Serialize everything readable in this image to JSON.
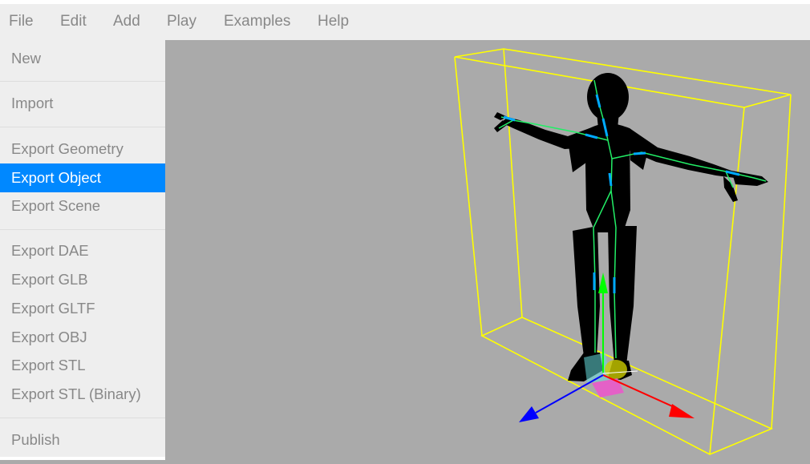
{
  "menubar": {
    "items": [
      {
        "label": "File"
      },
      {
        "label": "Edit"
      },
      {
        "label": "Add"
      },
      {
        "label": "Play"
      },
      {
        "label": "Examples"
      },
      {
        "label": "Help"
      }
    ]
  },
  "file_menu": {
    "new": "New",
    "import": "Import",
    "export_geometry": "Export Geometry",
    "export_object": "Export Object",
    "export_scene": "Export Scene",
    "export_dae": "Export DAE",
    "export_glb": "Export GLB",
    "export_gltf": "Export GLTF",
    "export_obj": "Export OBJ",
    "export_stl": "Export STL",
    "export_stl_binary": "Export STL (Binary)",
    "publish": "Publish",
    "active_item": "Export Object"
  },
  "viewport": {
    "background": "#aaaaaa",
    "selection_box_color": "#ffff00",
    "bone_color": "#22ee66",
    "joint_color": "#00aaff",
    "gizmo_x_color": "#ff0000",
    "gizmo_y_color": "#00ff00",
    "gizmo_z_color": "#0000ff"
  },
  "colors": {
    "highlight": "#0088ff",
    "menu_text": "#888888",
    "menu_background": "#eeeeee"
  }
}
